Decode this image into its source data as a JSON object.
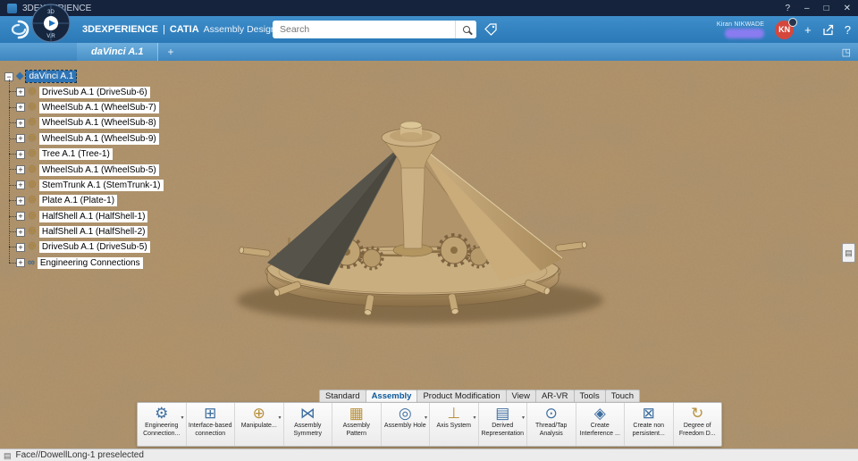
{
  "titlebar": {
    "app_name": "3DEXPERIENCE",
    "controls": [
      "?",
      "–",
      "□",
      "✕"
    ]
  },
  "header": {
    "brand": "3DEXPERIENCE",
    "divider": "|",
    "app": "CATIA",
    "workbench": "Assembly Design",
    "search": {
      "placeholder": "Search"
    },
    "user_name": "Kiran NIKWADE",
    "avatar_initials": "KN",
    "icons": {
      "add": "+",
      "help": "?"
    }
  },
  "compass": {
    "top_label": "3D",
    "bottom_label": "V.R"
  },
  "tabbar": {
    "active_tab": "daVinci A.1",
    "new_tab": "+",
    "expand_glyph": "◳"
  },
  "tree": {
    "root": {
      "label": "daVinci A.1",
      "expander": "−",
      "glyph": "◆",
      "color": "#2f6fae"
    },
    "items": [
      {
        "label": "DriveSub A.1 (DriveSub-6)",
        "expander": "+",
        "glyph": "⚙",
        "color": "#b98f3e"
      },
      {
        "label": "WheelSub A.1 (WheelSub-7)",
        "expander": "+",
        "glyph": "⚙",
        "color": "#b98f3e"
      },
      {
        "label": "WheelSub A.1 (WheelSub-8)",
        "expander": "+",
        "glyph": "⚙",
        "color": "#b98f3e"
      },
      {
        "label": "WheelSub A.1 (WheelSub-9)",
        "expander": "+",
        "glyph": "⚙",
        "color": "#b98f3e"
      },
      {
        "label": "Tree A.1 (Tree-1)",
        "expander": "+",
        "glyph": "⚙",
        "color": "#b98f3e"
      },
      {
        "label": "WheelSub A.1 (WheelSub-5)",
        "expander": "+",
        "glyph": "⚙",
        "color": "#b98f3e"
      },
      {
        "label": "StemTrunk A.1 (StemTrunk-1)",
        "expander": "+",
        "glyph": "⚙",
        "color": "#b98f3e"
      },
      {
        "label": "Plate A.1 (Plate-1)",
        "expander": "+",
        "glyph": "⚙",
        "color": "#b98f3e"
      },
      {
        "label": "HalfShell A.1 (HalfShell-1)",
        "expander": "+",
        "glyph": "⚙",
        "color": "#b98f3e"
      },
      {
        "label": "HalfShell A.1 (HalfShell-2)",
        "expander": "+",
        "glyph": "⚙",
        "color": "#b98f3e"
      },
      {
        "label": "DriveSub A.1 (DriveSub-5)",
        "expander": "+",
        "glyph": "⚙",
        "color": "#b98f3e"
      },
      {
        "label": "Engineering Connections",
        "expander": "+",
        "glyph": "∞",
        "color": "#2a6fb0"
      }
    ]
  },
  "viewport": {
    "widget_glyph": "▤"
  },
  "ribbon": {
    "tabs": [
      "Standard",
      "Assembly",
      "Product Modification",
      "View",
      "AR-VR",
      "Tools",
      "Touch"
    ],
    "active_tab": "Assembly",
    "dropdown_glyph": "▾",
    "tools": [
      {
        "label": "Engineering Connection...",
        "glyph": "⚙",
        "color": "#3f6fa0",
        "dropdown": true
      },
      {
        "label": "Interface-based connection",
        "glyph": "⊞",
        "color": "#3f6fa0",
        "dropdown": false
      },
      {
        "label": "Manipulate...",
        "glyph": "⊕",
        "color": "#b8913d",
        "dropdown": true
      },
      {
        "label": "Assembly Symmetry",
        "glyph": "⋈",
        "color": "#3f6fa0",
        "dropdown": false
      },
      {
        "label": "Assembly Pattern",
        "glyph": "▦",
        "color": "#b8913d",
        "dropdown": false
      },
      {
        "label": "Assembly Hole",
        "glyph": "◎",
        "color": "#3f6fa0",
        "dropdown": true
      },
      {
        "label": "Axis System",
        "glyph": "⊥",
        "color": "#b8913d",
        "dropdown": true
      },
      {
        "label": "Derived Representation",
        "glyph": "▤",
        "color": "#3f6fa0",
        "dropdown": true
      },
      {
        "label": "Thread/Tap Analysis",
        "glyph": "⊙",
        "color": "#3f6fa0",
        "dropdown": false
      },
      {
        "label": "Create Interference ...",
        "glyph": "◈",
        "color": "#3f6fa0",
        "dropdown": false
      },
      {
        "label": "Create non persistent...",
        "glyph": "⊠",
        "color": "#3f6fa0",
        "dropdown": false
      },
      {
        "label": "Degree of Freedom D...",
        "glyph": "↻",
        "color": "#b8913d",
        "dropdown": false
      }
    ]
  },
  "statusbar": {
    "text": "Face//DowellLong-1 preselected",
    "icon_glyph": "▤"
  }
}
